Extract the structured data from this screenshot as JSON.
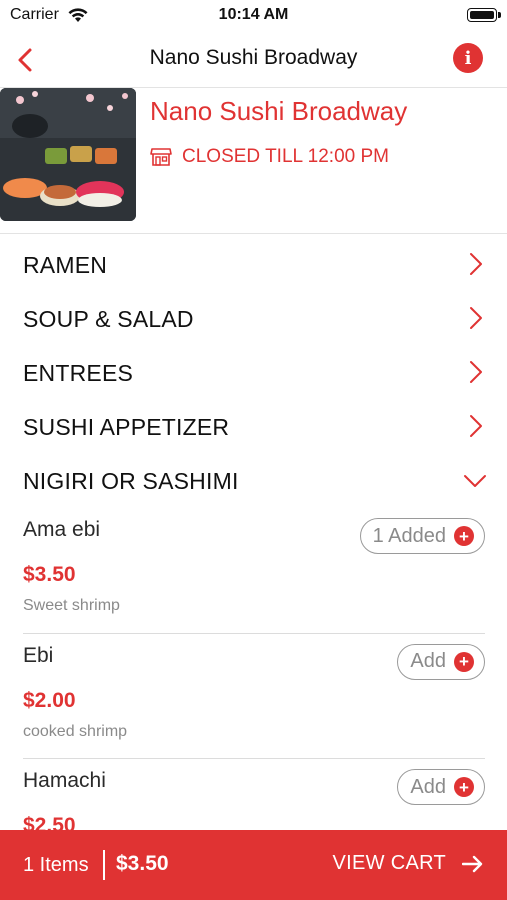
{
  "status_bar": {
    "carrier": "Carrier",
    "time": "10:14 AM"
  },
  "nav": {
    "title": "Nano Sushi Broadway",
    "info_icon": "info-icon",
    "back_icon": "chevron-left-icon"
  },
  "restaurant": {
    "name": "Nano Sushi Broadway",
    "status": "CLOSED TILL 12:00 PM",
    "status_icon": "storefront-icon"
  },
  "categories": [
    {
      "label": "RAMEN",
      "expanded": false
    },
    {
      "label": "SOUP & SALAD",
      "expanded": false
    },
    {
      "label": "ENTREES",
      "expanded": false
    },
    {
      "label": "SUSHI APPETIZER",
      "expanded": false
    },
    {
      "label": "NIGIRI OR SASHIMI",
      "expanded": true
    }
  ],
  "items": [
    {
      "name": "Ama ebi",
      "price": "$3.50",
      "description": "Sweet shrimp",
      "button": "1 Added"
    },
    {
      "name": "Ebi",
      "price": "$2.00",
      "description": "cooked shrimp",
      "button": "Add"
    },
    {
      "name": "Hamachi",
      "price": "$2.50",
      "description": "",
      "button": "Add"
    }
  ],
  "cart": {
    "items": "1 Items",
    "total": "$3.50",
    "action": "VIEW CART"
  },
  "colors": {
    "accent": "#e03333",
    "text": "#1a1a1a",
    "muted": "#8a8a8a"
  }
}
